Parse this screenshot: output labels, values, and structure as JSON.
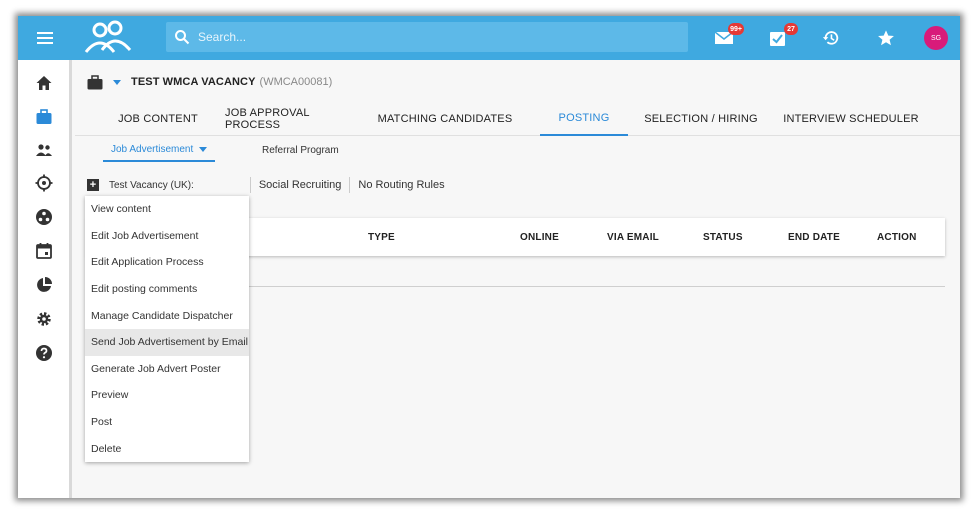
{
  "topbar": {
    "search_placeholder": "Search...",
    "mail_badge": "99+",
    "tasks_badge": "27",
    "avatar_initials": "SG"
  },
  "vacancy": {
    "title": "TEST WMCA VACANCY",
    "code": "(WMCA00081)"
  },
  "tabs": [
    {
      "label": "JOB CONTENT"
    },
    {
      "label": "JOB APPROVAL PROCESS"
    },
    {
      "label": "MATCHING CANDIDATES"
    },
    {
      "label": "POSTING"
    },
    {
      "label": "SELECTION / HIRING"
    },
    {
      "label": "INTERVIEW SCHEDULER"
    }
  ],
  "subtabs": [
    {
      "label": "Job Advertisement"
    },
    {
      "label": "Referral Program"
    }
  ],
  "routing": {
    "vacancy_label": "Test Vacancy   (UK):",
    "social": "Social Recruiting",
    "rules": "No Routing Rules"
  },
  "table": {
    "columns": [
      "TYPE",
      "ONLINE",
      "VIA EMAIL",
      "STATUS",
      "END DATE",
      "ACTION"
    ]
  },
  "dropdown": {
    "items": [
      "View content",
      "Edit Job Advertisement",
      "Edit Application Process",
      "Edit posting comments",
      "Manage Candidate Dispatcher",
      "Send Job Advertisement by Email",
      "Generate Job Advert Poster",
      "Preview",
      "Post",
      "Delete"
    ]
  },
  "colors": {
    "topbar": "#3fa9e0",
    "accent": "#2b8ad8",
    "badge": "#e53935",
    "avatar": "#d81b7a"
  }
}
